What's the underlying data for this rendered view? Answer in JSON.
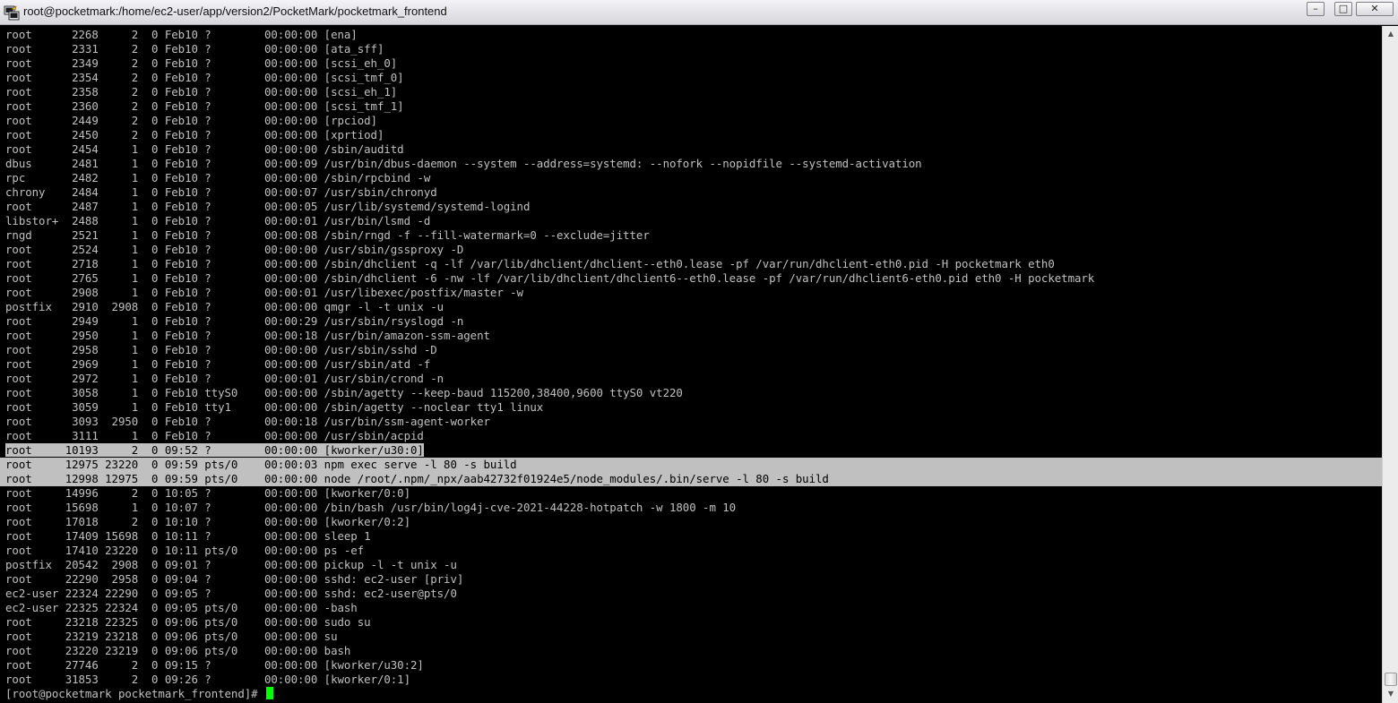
{
  "window": {
    "title": "root@pocketmark:/home/ec2-user/app/version2/PocketMark/pocketmark_frontend",
    "min_label": "–",
    "max_label": "□",
    "close_label": "✕"
  },
  "terminal": {
    "lines": [
      "root      2268     2  0 Feb10 ?        00:00:00 [ena]",
      "root      2331     2  0 Feb10 ?        00:00:00 [ata_sff]",
      "root      2349     2  0 Feb10 ?        00:00:00 [scsi_eh_0]",
      "root      2354     2  0 Feb10 ?        00:00:00 [scsi_tmf_0]",
      "root      2358     2  0 Feb10 ?        00:00:00 [scsi_eh_1]",
      "root      2360     2  0 Feb10 ?        00:00:00 [scsi_tmf_1]",
      "root      2449     2  0 Feb10 ?        00:00:00 [rpciod]",
      "root      2450     2  0 Feb10 ?        00:00:00 [xprtiod]",
      "root      2454     1  0 Feb10 ?        00:00:00 /sbin/auditd",
      "dbus      2481     1  0 Feb10 ?        00:00:09 /usr/bin/dbus-daemon --system --address=systemd: --nofork --nopidfile --systemd-activation",
      "rpc       2482     1  0 Feb10 ?        00:00:00 /sbin/rpcbind -w",
      "chrony    2484     1  0 Feb10 ?        00:00:07 /usr/sbin/chronyd",
      "root      2487     1  0 Feb10 ?        00:00:05 /usr/lib/systemd/systemd-logind",
      "libstor+  2488     1  0 Feb10 ?        00:00:01 /usr/bin/lsmd -d",
      "rngd      2521     1  0 Feb10 ?        00:00:08 /sbin/rngd -f --fill-watermark=0 --exclude=jitter",
      "root      2524     1  0 Feb10 ?        00:00:00 /usr/sbin/gssproxy -D",
      "root      2718     1  0 Feb10 ?        00:00:00 /sbin/dhclient -q -lf /var/lib/dhclient/dhclient--eth0.lease -pf /var/run/dhclient-eth0.pid -H pocketmark eth0",
      "root      2765     1  0 Feb10 ?        00:00:00 /sbin/dhclient -6 -nw -lf /var/lib/dhclient/dhclient6--eth0.lease -pf /var/run/dhclient6-eth0.pid eth0 -H pocketmark",
      "root      2908     1  0 Feb10 ?        00:00:01 /usr/libexec/postfix/master -w",
      "postfix   2910  2908  0 Feb10 ?        00:00:00 qmgr -l -t unix -u",
      "root      2949     1  0 Feb10 ?        00:00:29 /usr/sbin/rsyslogd -n",
      "root      2950     1  0 Feb10 ?        00:00:18 /usr/bin/amazon-ssm-agent",
      "root      2958     1  0 Feb10 ?        00:00:00 /usr/sbin/sshd -D",
      "root      2969     1  0 Feb10 ?        00:00:00 /usr/sbin/atd -f",
      "root      2972     1  0 Feb10 ?        00:00:01 /usr/sbin/crond -n",
      "root      3058     1  0 Feb10 ttyS0    00:00:00 /sbin/agetty --keep-baud 115200,38400,9600 ttyS0 vt220",
      "root      3059     1  0 Feb10 tty1     00:00:00 /sbin/agetty --noclear tty1 linux",
      "root      3093  2950  0 Feb10 ?        00:00:18 /usr/bin/ssm-agent-worker",
      "root      3111     1  0 Feb10 ?        00:00:00 /usr/sbin/acpid",
      "root     10193     2  0 09:52 ?        00:00:00 [kworker/u30:0]",
      "root     12975 23220  0 09:59 pts/0    00:00:03 npm exec serve -l 80 -s build",
      "root     12998 12975  0 09:59 pts/0    00:00:00 node /root/.npm/_npx/aab42732f01924e5/node_modules/.bin/serve -l 80 -s build",
      "root     14996     2  0 10:05 ?        00:00:00 [kworker/0:0]",
      "root     15698     1  0 10:07 ?        00:00:00 /bin/bash /usr/bin/log4j-cve-2021-44228-hotpatch -w 1800 -m 10",
      "root     17018     2  0 10:10 ?        00:00:00 [kworker/0:2]",
      "root     17409 15698  0 10:11 ?        00:00:00 sleep 1",
      "root     17410 23220  0 10:11 pts/0    00:00:00 ps -ef",
      "postfix  20542  2908  0 09:01 ?        00:00:00 pickup -l -t unix -u",
      "root     22290  2958  0 09:04 ?        00:00:00 sshd: ec2-user [priv]",
      "ec2-user 22324 22290  0 09:05 ?        00:00:00 sshd: ec2-user@pts/0",
      "ec2-user 22325 22324  0 09:05 pts/0    00:00:00 -bash",
      "root     23218 22325  0 09:06 pts/0    00:00:00 sudo su",
      "root     23219 23218  0 09:06 pts/0    00:00:00 su",
      "root     23220 23219  0 09:06 pts/0    00:00:00 bash",
      "root     27746     2  0 09:15 ?        00:00:00 [kworker/u30:2]",
      "root     31853     2  0 09:26 ?        00:00:00 [kworker/0:1]"
    ],
    "prompt": "[root@pocketmark pocketmark_frontend]# "
  },
  "colors": {
    "background": "#000000",
    "text": "#c0c0c0",
    "selection": "#c0c0c0",
    "cursor": "#00ff00"
  },
  "icons": {
    "app": "putty-icon",
    "scroll_up": "up-arrow-icon",
    "scroll_down": "down-arrow-icon"
  }
}
